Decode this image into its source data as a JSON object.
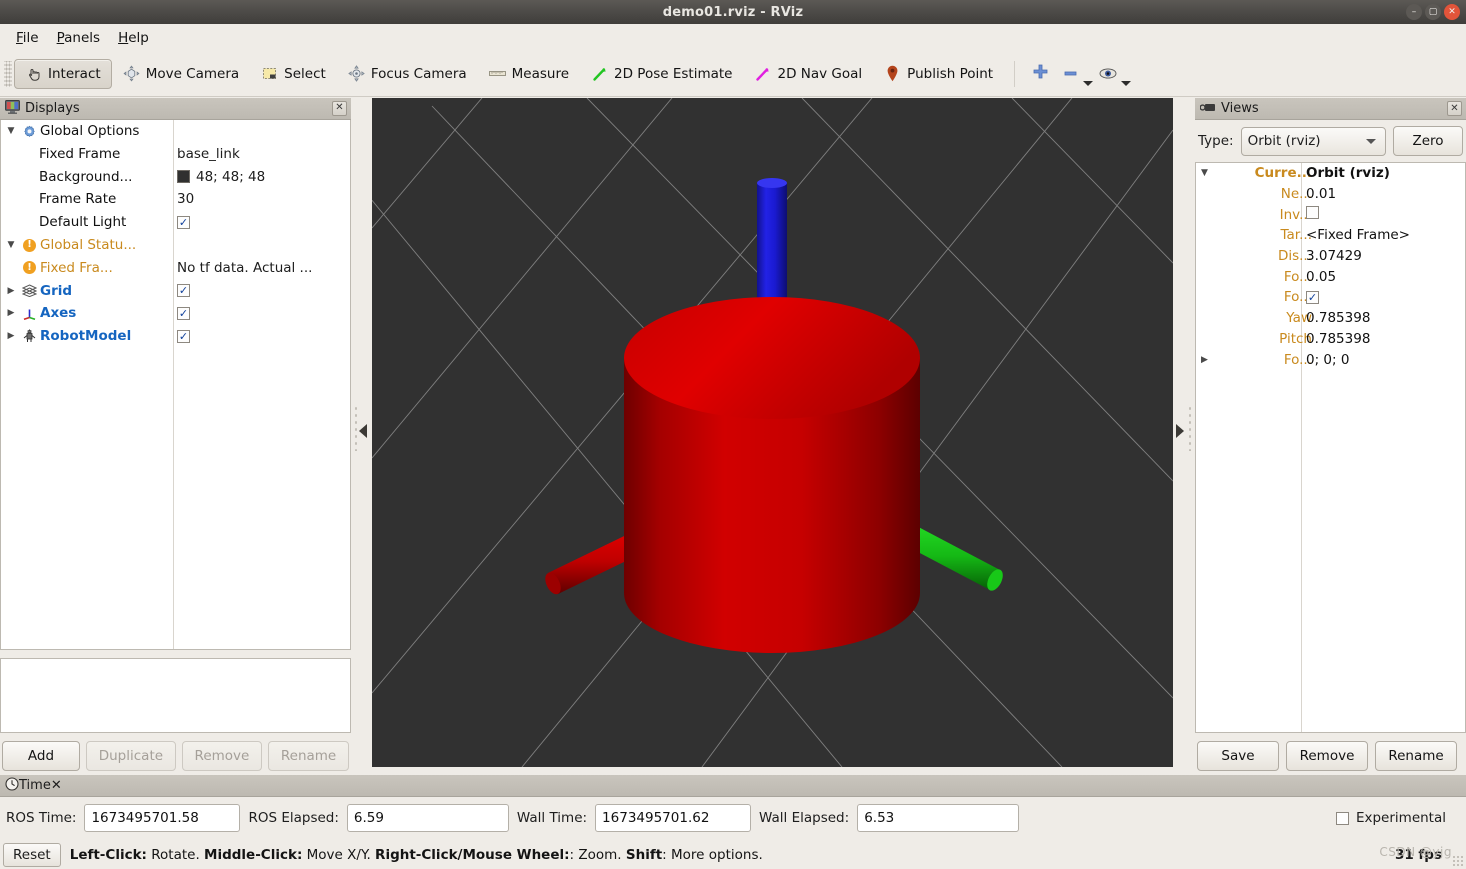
{
  "window": {
    "title": "demo01.rviz - RViz",
    "controls": {
      "minimize": "–",
      "maximize": "▢",
      "close": "✕"
    }
  },
  "menubar": {
    "items": [
      {
        "label": "File",
        "mnemonic": "F"
      },
      {
        "label": "Panels",
        "mnemonic": "P"
      },
      {
        "label": "Help",
        "mnemonic": "H"
      }
    ]
  },
  "toolbar": {
    "tools": [
      {
        "label": "Interact",
        "icon": "hand-cursor-icon",
        "active": true
      },
      {
        "label": "Move Camera",
        "icon": "move-camera-icon",
        "active": false
      },
      {
        "label": "Select",
        "icon": "select-rectangle-icon",
        "active": false
      },
      {
        "label": "Focus Camera",
        "icon": "focus-camera-icon",
        "active": false
      },
      {
        "label": "Measure",
        "icon": "ruler-icon",
        "active": false
      },
      {
        "label": "2D Pose Estimate",
        "icon": "pose-arrow-green-icon",
        "active": false
      },
      {
        "label": "2D Nav Goal",
        "icon": "nav-arrow-magenta-icon",
        "active": false
      },
      {
        "label": "Publish Point",
        "icon": "map-pin-icon",
        "active": false
      }
    ],
    "extra": [
      {
        "name": "add-tool-button",
        "icon": "plus-icon"
      },
      {
        "name": "remove-tool-button",
        "icon": "minus-icon"
      },
      {
        "name": "tool-properties-button",
        "icon": "eye-icon"
      }
    ]
  },
  "displays": {
    "header": {
      "title": "Displays",
      "icon": "monitor-icon",
      "close": "✕"
    },
    "rows": [
      {
        "indent": 0,
        "arrow": "▼",
        "icon": "gear-icon",
        "label": "Global Options",
        "label_style": "plain",
        "value": "",
        "value_type": "none"
      },
      {
        "indent": 1,
        "arrow": "",
        "icon": "",
        "label": "Fixed Frame",
        "label_style": "plain",
        "value": "base_link",
        "value_type": "text"
      },
      {
        "indent": 1,
        "arrow": "",
        "icon": "",
        "label": "Background...",
        "label_style": "plain",
        "value": "48; 48; 48",
        "value_type": "color",
        "color": "#303030"
      },
      {
        "indent": 1,
        "arrow": "",
        "icon": "",
        "label": "Frame Rate",
        "label_style": "plain",
        "value": "30",
        "value_type": "text"
      },
      {
        "indent": 1,
        "arrow": "",
        "icon": "",
        "label": "Default Light",
        "label_style": "plain",
        "value": "✓",
        "value_type": "checkbox"
      },
      {
        "indent": 0,
        "arrow": "▼",
        "icon": "warning-icon",
        "label": "Global Statu...",
        "label_style": "orange",
        "value": "",
        "value_type": "none"
      },
      {
        "indent": 1,
        "arrow": "",
        "icon": "warning-icon",
        "label": "Fixed Fra...",
        "label_style": "orange",
        "value": "No tf data.  Actual ...",
        "value_type": "text"
      },
      {
        "indent": 0,
        "arrow": "▶",
        "icon": "grid-icon",
        "label": "Grid",
        "label_style": "blue",
        "value": "✓",
        "value_type": "checkbox"
      },
      {
        "indent": 0,
        "arrow": "▶",
        "icon": "axes-icon",
        "label": "Axes",
        "label_style": "blue",
        "value": "✓",
        "value_type": "checkbox"
      },
      {
        "indent": 0,
        "arrow": "▶",
        "icon": "robot-icon",
        "label": "RobotModel",
        "label_style": "blue",
        "value": "✓",
        "value_type": "checkbox"
      }
    ],
    "buttons": [
      {
        "label": "Add",
        "enabled": true
      },
      {
        "label": "Duplicate",
        "enabled": false
      },
      {
        "label": "Remove",
        "enabled": false
      },
      {
        "label": "Rename",
        "enabled": false
      }
    ]
  },
  "views": {
    "header": {
      "title": "Views",
      "icon": "camera-icon",
      "close": "✕"
    },
    "type_label": "Type:",
    "type_value": "Orbit (rviz)",
    "zero_label": "Zero",
    "rows": [
      {
        "arrow": "▼",
        "key": "Curre...",
        "key_bold": true,
        "value": "Orbit (rviz)",
        "value_bold": true,
        "value_type": "text"
      },
      {
        "arrow": "",
        "key": "Ne...",
        "key_bold": false,
        "value": "0.01",
        "value_bold": false,
        "value_type": "text"
      },
      {
        "arrow": "",
        "key": "Inv...",
        "key_bold": false,
        "value": "",
        "value_bold": false,
        "value_type": "checkbox-unchecked"
      },
      {
        "arrow": "",
        "key": "Tar...",
        "key_bold": false,
        "value": "<Fixed Frame>",
        "value_bold": false,
        "value_type": "text"
      },
      {
        "arrow": "",
        "key": "Dis...",
        "key_bold": false,
        "value": "3.07429",
        "value_bold": false,
        "value_type": "text"
      },
      {
        "arrow": "",
        "key": "Fo...",
        "key_bold": false,
        "value": "0.05",
        "value_bold": false,
        "value_type": "text"
      },
      {
        "arrow": "",
        "key": "Fo...",
        "key_bold": false,
        "value": "✓",
        "value_bold": false,
        "value_type": "checkbox"
      },
      {
        "arrow": "",
        "key": "Yaw",
        "key_bold": false,
        "value": "0.785398",
        "value_bold": false,
        "value_type": "text"
      },
      {
        "arrow": "",
        "key": "Pitch",
        "key_bold": false,
        "value": "0.785398",
        "value_bold": false,
        "value_type": "text"
      },
      {
        "arrow": "▶",
        "key": "Fo...",
        "key_bold": false,
        "value": "0; 0; 0",
        "value_bold": false,
        "value_type": "text"
      }
    ],
    "buttons": [
      {
        "label": "Save"
      },
      {
        "label": "Remove"
      },
      {
        "label": "Rename"
      }
    ]
  },
  "time": {
    "header": {
      "title": "Time",
      "icon": "clock-icon",
      "close": "✕"
    },
    "fields": [
      {
        "label": "ROS Time:",
        "value": "1673495701.58"
      },
      {
        "label": "ROS Elapsed:",
        "value": "6.59"
      },
      {
        "label": "Wall Time:",
        "value": "1673495701.62"
      },
      {
        "label": "Wall Elapsed:",
        "value": "6.53"
      }
    ],
    "experimental_label": "Experimental",
    "experimental_checked": false
  },
  "statusbar": {
    "reset_label": "Reset",
    "hint_parts": [
      {
        "text": "Left-Click:",
        "bold": true
      },
      {
        "text": " Rotate. ",
        "bold": false
      },
      {
        "text": "Middle-Click:",
        "bold": true
      },
      {
        "text": " Move X/Y. ",
        "bold": false
      },
      {
        "text": "Right-Click/Mouse Wheel:",
        "bold": true
      },
      {
        "text": ": Zoom. ",
        "bold": false
      },
      {
        "text": "Shift",
        "bold": true
      },
      {
        "text": ": More options.",
        "bold": false
      }
    ],
    "fps": "31 fps",
    "watermark": "CSDN @yjg"
  },
  "viewport": {
    "background_color": "#313131",
    "grid_line_color": "#b4b4b4",
    "scene_objects": [
      {
        "name": "base-cylinder",
        "color": "#cc0000",
        "shape": "cylinder"
      },
      {
        "name": "top-post-cylinder",
        "color": "#1414d2",
        "shape": "cylinder"
      },
      {
        "name": "left-axis-cylinder",
        "color": "#d40000",
        "shape": "cylinder"
      },
      {
        "name": "right-axis-cylinder",
        "color": "#12c212",
        "shape": "cylinder"
      }
    ]
  }
}
